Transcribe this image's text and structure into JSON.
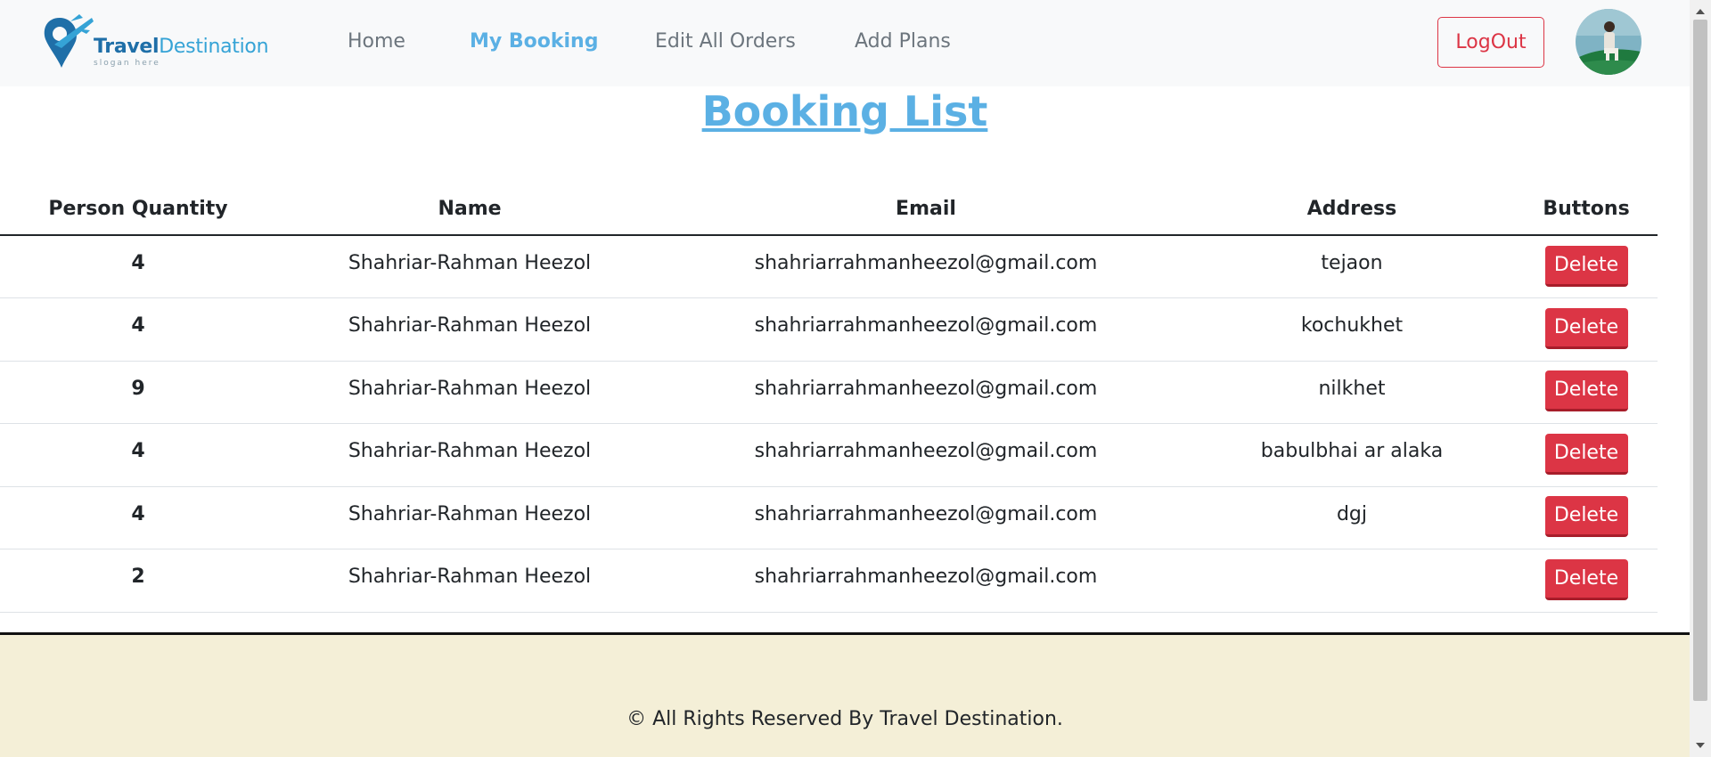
{
  "brand": {
    "name_part1": "Travel",
    "name_part2": "Destination",
    "slogan": "slogan here"
  },
  "nav": {
    "links": [
      {
        "label": "Home"
      },
      {
        "label": "My Booking",
        "active": true
      },
      {
        "label": "Edit All Orders"
      },
      {
        "label": "Add Plans"
      }
    ],
    "logout_label": "LogOut"
  },
  "page_title": "Booking List",
  "table": {
    "headers": [
      "Person Quantity",
      "Name",
      "Email",
      "Address",
      "Buttons"
    ],
    "rows": [
      {
        "qty": "4",
        "name": "Shahriar-Rahman Heezol",
        "email": "shahriarrahmanheezol@gmail.com",
        "address": "tejaon",
        "button": "Delete"
      },
      {
        "qty": "4",
        "name": "Shahriar-Rahman Heezol",
        "email": "shahriarrahmanheezol@gmail.com",
        "address": "kochukhet",
        "button": "Delete"
      },
      {
        "qty": "9",
        "name": "Shahriar-Rahman Heezol",
        "email": "shahriarrahmanheezol@gmail.com",
        "address": "nilkhet",
        "button": "Delete"
      },
      {
        "qty": "4",
        "name": "Shahriar-Rahman Heezol",
        "email": "shahriarrahmanheezol@gmail.com",
        "address": "babulbhai ar alaka",
        "button": "Delete"
      },
      {
        "qty": "4",
        "name": "Shahriar-Rahman Heezol",
        "email": "shahriarrahmanheezol@gmail.com",
        "address": "dgj",
        "button": "Delete"
      },
      {
        "qty": "2",
        "name": "Shahriar-Rahman Heezol",
        "email": "shahriarrahmanheezol@gmail.com",
        "address": "",
        "button": "Delete"
      }
    ]
  },
  "footer": {
    "text": "© All Rights Reserved By Travel Destination."
  },
  "colors": {
    "accent": "#5bb0e4",
    "danger": "#dc3545",
    "navbar_bg": "#f8f9fa",
    "footer_bg": "#f4efd7"
  },
  "icons": {
    "logo": "map-pin-airplane-icon",
    "avatar": "user-avatar"
  }
}
